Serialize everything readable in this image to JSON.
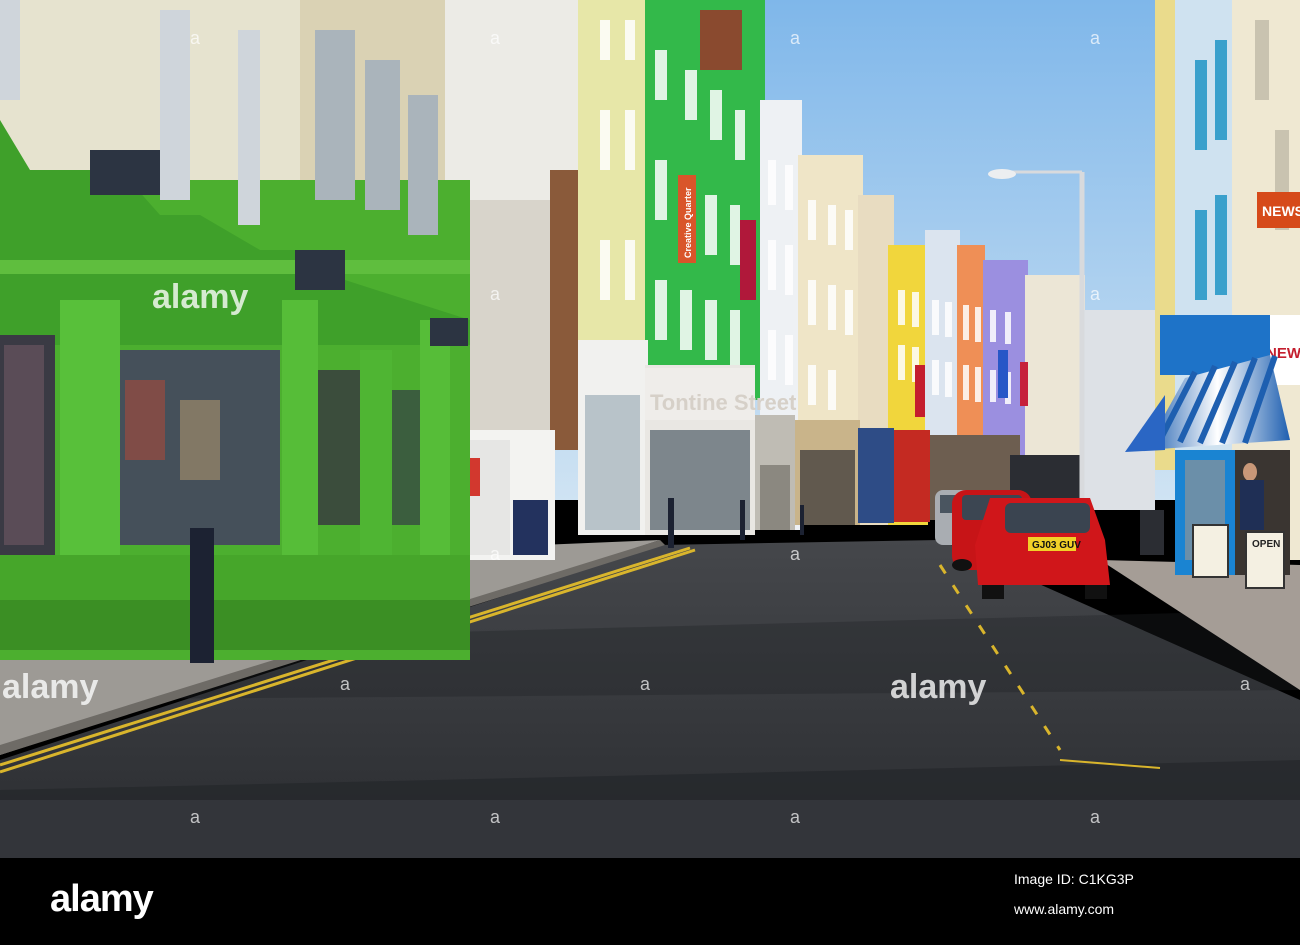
{
  "photo": {
    "watermark": "alamy",
    "signs": {
      "shop_front": "Creative Quarter",
      "banner_left": "Creative Quarter",
      "shopfront_lettering": "Tontine Street",
      "car_plate": "GJ03 GUV",
      "newsagent": "NEWSA",
      "open_sign": "OPEN"
    },
    "colors": {
      "sky": "#8ec2ee",
      "green_shopfront": "#4caf2f",
      "road": "#303236",
      "car": "#d0161a"
    }
  },
  "footer": {
    "logo": "alamy",
    "image_id": "Image ID: C1KG3P",
    "url": "www.alamy.com"
  }
}
